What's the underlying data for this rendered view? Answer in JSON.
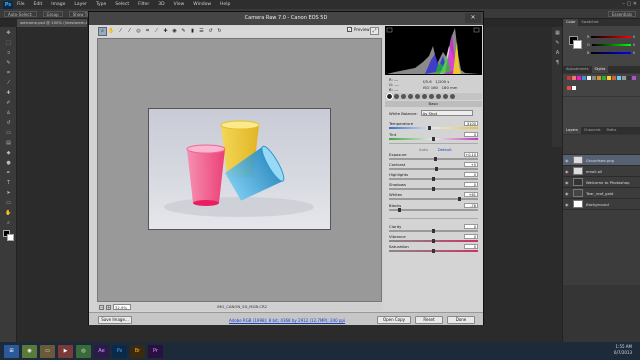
{
  "app": {
    "logo": "Ps",
    "menu": [
      "File",
      "Edit",
      "Image",
      "Layer",
      "Type",
      "Select",
      "Filter",
      "3D",
      "View",
      "Window",
      "Help"
    ],
    "options": [
      "Auto-Select:",
      "Group",
      "Show Transform Controls"
    ],
    "workspace": "Essentials",
    "doc_tab": "welcome.psd @ 100% (lineslorem-test)",
    "status": "Doc: 2.79M/16.8M",
    "zoom_status": "100%"
  },
  "camera_raw": {
    "title": "Camera Raw 7.0  -  Canon EOS 5D",
    "preview_label": "Preview",
    "preview_checked": true,
    "zoom": "32.9%",
    "filename": "IMG_CANON_5D_MGB.CR2",
    "workflow": "Adobe RGB (1998); 8 bit; 4368 by 2912 (12.7MP); 240 ppi",
    "buttons": {
      "save": "Save Image...",
      "open": "Open Copy",
      "reset": "Reset",
      "done": "Done"
    },
    "histogram_info": {
      "aperture": "f/5.6",
      "shutter": "1/200 s",
      "iso": "ISO 160",
      "focal": "180 mm",
      "rgb_r": "R:",
      "rgb_g": "G:",
      "rgb_b": "B:",
      "dashes": "---"
    },
    "panel_title": "Basic",
    "white_balance": {
      "label": "White Balance:",
      "value": "As Shot"
    },
    "auto_label": "Auto",
    "default_label": "Default",
    "adjustments": [
      {
        "label": "Temperature",
        "value": "5100",
        "pos": 0.45
      },
      {
        "label": "Tint",
        "value": "0",
        "pos": 0.5
      },
      {
        "label": "Exposure",
        "value": "+0.10",
        "pos": 0.52
      },
      {
        "label": "Contrast",
        "value": "+5",
        "pos": 0.53
      },
      {
        "label": "Highlights",
        "value": "0",
        "pos": 0.5
      },
      {
        "label": "Shadows",
        "value": "0",
        "pos": 0.5
      },
      {
        "label": "Whites",
        "value": "+61",
        "pos": 0.8
      },
      {
        "label": "Blacks",
        "value": "-78",
        "pos": 0.11
      },
      {
        "label": "Clarity",
        "value": "0",
        "pos": 0.5
      },
      {
        "label": "Vibrance",
        "value": "0",
        "pos": 0.5
      },
      {
        "label": "Saturation",
        "value": "0",
        "pos": 0.5
      }
    ]
  },
  "panels": {
    "color_tabs": [
      "Color",
      "Swatches"
    ],
    "rgb": [
      {
        "label": "R",
        "value": "0"
      },
      {
        "label": "G",
        "value": "0"
      },
      {
        "label": "B",
        "value": "0"
      }
    ],
    "adj_tabs": [
      "Adjustments",
      "Styles"
    ],
    "layer_tabs": [
      "Layers",
      "Channels",
      "Paths"
    ],
    "layers": [
      {
        "name": "Grounfsea.png",
        "selected": true
      },
      {
        "name": "email.ali"
      },
      {
        "name": "Welcome to Photoshop"
      },
      {
        "name": "Tear_roof_gold"
      },
      {
        "name": "Background"
      }
    ]
  },
  "taskbar": {
    "icons": [
      "Chrome",
      "Explorer",
      "Media",
      "Sync",
      "Ae",
      "Ps",
      "Br",
      "Pr"
    ],
    "time": "1:55 AM",
    "date": "6/7/2013"
  },
  "colors": {
    "accent_blue": "#1a3fc0",
    "cup_pink": "#f2457b",
    "cup_yellow": "#f4c71a",
    "cup_blue": "#2a9ad0"
  }
}
